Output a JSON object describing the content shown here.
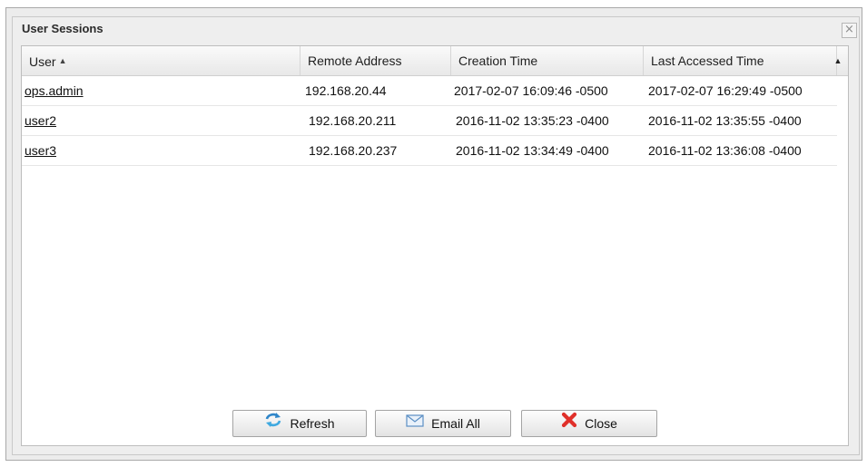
{
  "dialog": {
    "title": "User Sessions",
    "close_glyph": "×"
  },
  "grid": {
    "columns": [
      {
        "label": "User",
        "sorted": "ascending"
      },
      {
        "label": "Remote Address"
      },
      {
        "label": "Creation Time"
      },
      {
        "label": "Last Accessed Time"
      }
    ],
    "sort_glyph": "▲",
    "scroll_glyph": "▲",
    "rows": [
      {
        "user": "ops.admin",
        "remote_address": "192.168.20.44",
        "creation_time": "2017-02-07 16:09:46 -0500",
        "last_accessed": "2017-02-07 16:29:49 -0500"
      },
      {
        "user": "user2",
        "remote_address": "192.168.20.211",
        "creation_time": "2016-11-02 13:35:23 -0400",
        "last_accessed": "2016-11-02 13:35:55 -0400"
      },
      {
        "user": "user3",
        "remote_address": "192.168.20.237",
        "creation_time": "2016-11-02 13:34:49 -0400",
        "last_accessed": "2016-11-02 13:36:08 -0400"
      }
    ]
  },
  "buttons": {
    "refresh": {
      "label": "Refresh",
      "icon": "refresh-icon"
    },
    "email_all": {
      "label": "Email All",
      "icon": "envelope-icon"
    },
    "close": {
      "label": "Close",
      "icon": "red-x-icon"
    }
  },
  "colors": {
    "refresh_icon": "#2f86c9",
    "envelope_icon": "#5b8fc4",
    "close_icon": "#e0302a"
  }
}
